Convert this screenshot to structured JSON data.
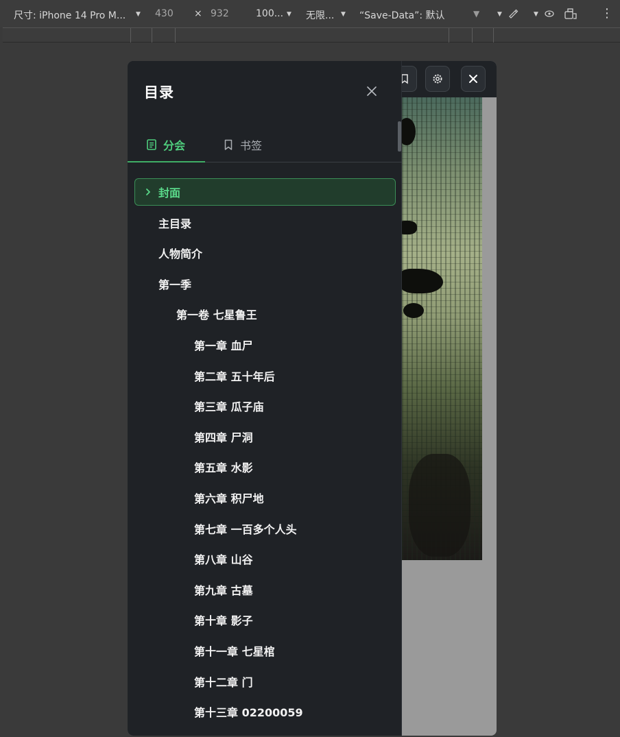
{
  "devtools": {
    "device_label": "尺寸: iPhone 14 Pro M...",
    "width": "430",
    "times": "×",
    "height": "932",
    "zoom": "100...",
    "throttle": "无限...",
    "save_data": "“Save-Data”: 默认",
    "more": "⋮"
  },
  "toolbar": {
    "settings_icon": "gear-icon",
    "close_icon": "close-icon"
  },
  "drawer": {
    "title": "目录",
    "tabs": [
      {
        "label": "分会",
        "icon": "list-icon",
        "active": true
      },
      {
        "label": "书签",
        "icon": "bookmark-icon",
        "active": false
      }
    ],
    "items": [
      {
        "label": "封面",
        "level": 0,
        "active": true
      },
      {
        "label": "主目录",
        "level": 0
      },
      {
        "label": "人物简介",
        "level": 0
      },
      {
        "label": "第一季",
        "level": 0
      },
      {
        "label": "第一卷 七星鲁王",
        "level": 1
      },
      {
        "label": "第一章 血尸",
        "level": 2
      },
      {
        "label": "第二章 五十年后",
        "level": 2
      },
      {
        "label": "第三章 瓜子庙",
        "level": 2
      },
      {
        "label": "第四章 尸洞",
        "level": 2
      },
      {
        "label": "第五章 水影",
        "level": 2
      },
      {
        "label": "第六章 积尸地",
        "level": 2
      },
      {
        "label": "第七章 一百多个人头",
        "level": 2
      },
      {
        "label": "第八章 山谷",
        "level": 2
      },
      {
        "label": "第九章 古墓",
        "level": 2
      },
      {
        "label": "第十章 影子",
        "level": 2
      },
      {
        "label": "第十一章 七星棺",
        "level": 2
      },
      {
        "label": "第十二章 门",
        "level": 2
      },
      {
        "label": "第十三章 02200059",
        "level": 2
      }
    ]
  },
  "colors": {
    "accent": "#4fce7d",
    "drawer_bg": "#1f2226",
    "active_bg": "#213d2c"
  }
}
